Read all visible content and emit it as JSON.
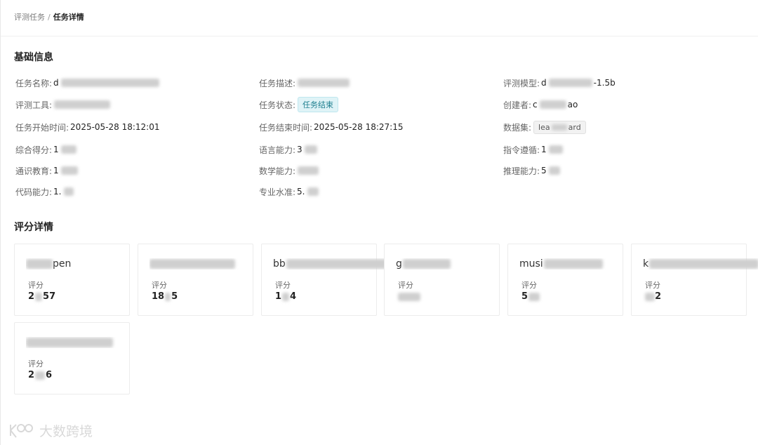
{
  "breadcrumb": {
    "parent": "评测任务",
    "separator": "/",
    "current": "任务详情"
  },
  "basic_info": {
    "section_title": "基础信息",
    "task_name": {
      "label": "任务名称:",
      "value": "d"
    },
    "task_desc": {
      "label": "任务描述:",
      "value": ""
    },
    "eval_model": {
      "label": "评测模型:",
      "value": "d",
      "suffix": "-1.5b"
    },
    "eval_tool": {
      "label": "评测工具:",
      "value": ""
    },
    "task_status": {
      "label": "任务状态:",
      "value": "任务结束"
    },
    "creator": {
      "label": "创建者:",
      "value": "c",
      "suffix": "ao"
    },
    "start_time": {
      "label": "任务开始时间:",
      "value": "2025-05-28 18:12:01"
    },
    "end_time": {
      "label": "任务结束时间:",
      "value": "2025-05-28 18:27:15"
    },
    "dataset": {
      "label": "数据集:",
      "value": "lea",
      "suffix": "ard"
    },
    "overall_score": {
      "label": "综合得分:",
      "value": "1"
    },
    "language": {
      "label": "语言能力:",
      "value": "3"
    },
    "instruction": {
      "label": "指令遵循:",
      "value": "1"
    },
    "general_knowledge": {
      "label": "通识教育:",
      "value": "1"
    },
    "math": {
      "label": "数学能力:",
      "value": ""
    },
    "reasoning": {
      "label": "推理能力:",
      "value": "5"
    },
    "coding": {
      "label": "代码能力:",
      "value": "1."
    },
    "professional": {
      "label": "专业水准:",
      "value": "5."
    }
  },
  "score_details": {
    "section_title": "评分详情",
    "score_label": "评分",
    "cards": [
      {
        "title": "pen",
        "score_prefix": "2",
        "score_suffix": "57"
      },
      {
        "title": "",
        "score_prefix": "18",
        "score_suffix": "5"
      },
      {
        "title": "bb",
        "score_prefix": "1",
        "score_suffix": "4"
      },
      {
        "title": "g",
        "score_prefix": "",
        "score_suffix": ""
      },
      {
        "title": "musi",
        "score_prefix": "5",
        "score_suffix": ""
      },
      {
        "title": "k",
        "score_prefix": "",
        "score_suffix": "2"
      },
      {
        "title": "",
        "score_prefix": "2",
        "score_suffix": "6"
      }
    ]
  },
  "watermark": {
    "text": "大数跨境"
  },
  "colors": {
    "status_tag_bg": "#dff3f7",
    "status_tag_text": "#1f7f8f"
  }
}
